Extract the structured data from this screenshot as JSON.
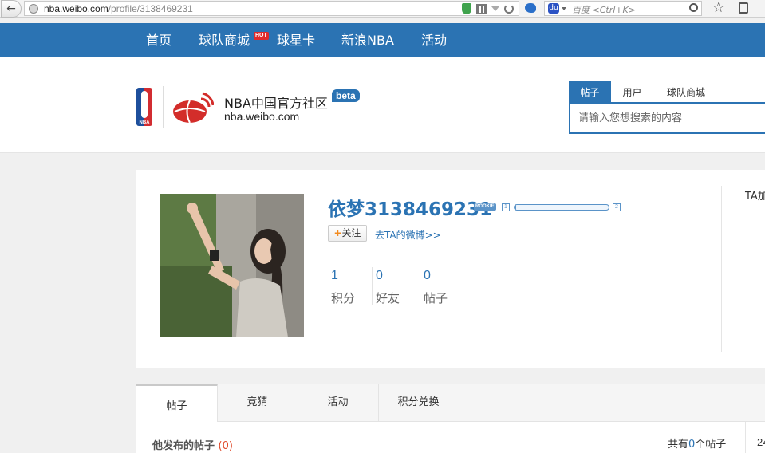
{
  "browser": {
    "url_domain": "nba.weibo.com",
    "url_path": "/profile/3138469231",
    "search_placeholder": "百度 <Ctrl+K>",
    "search_engine_glyph": "du",
    "icons": [
      "back-arrow-icon",
      "globe-icon",
      "shield-icon",
      "qr-code-icon",
      "dropdown-icon",
      "reload-icon",
      "bird-icon",
      "baidu-paw-icon",
      "search-icon",
      "star-icon",
      "clipboard-icon"
    ]
  },
  "nav": {
    "items": [
      {
        "label": "首页"
      },
      {
        "label": "球队商城",
        "badge": "HOT"
      },
      {
        "label": "球星卡"
      },
      {
        "label": "新浪NBA"
      },
      {
        "label": "活动"
      }
    ]
  },
  "header": {
    "logo_text": "NBA",
    "site_name": "NBA中国官方社区",
    "beta": "beta",
    "domain": "nba.weibo.com",
    "search_tabs": [
      "帖子",
      "用户",
      "球队商城"
    ],
    "search_placeholder": "请输入您想搜索的内容"
  },
  "profile": {
    "username": "依梦3138469231",
    "rank_badge": "ROOKIE",
    "level_current": "1",
    "level_next": "2",
    "level_progress": 0.02,
    "follow_label": "关注",
    "follow_plus": "+",
    "weibo_link": "去TA的微博>>",
    "stats": [
      {
        "value": "1",
        "label": "积分"
      },
      {
        "value": "0",
        "label": "好友"
      },
      {
        "value": "0",
        "label": "帖子"
      }
    ],
    "side_text": "TA加"
  },
  "tabs": [
    "帖子",
    "竞猜",
    "活动",
    "积分兑换"
  ],
  "posts": {
    "title": "他发布的帖子",
    "count_display": "(0)",
    "total_prefix": "共有",
    "total_count": "0",
    "total_suffix": "个帖子",
    "side_number": "24"
  },
  "colors": {
    "brand_blue": "#2b73b3",
    "hot_red": "#e02b2b",
    "count_red": "#e04a2b",
    "follow_orange": "#f28a1f"
  }
}
